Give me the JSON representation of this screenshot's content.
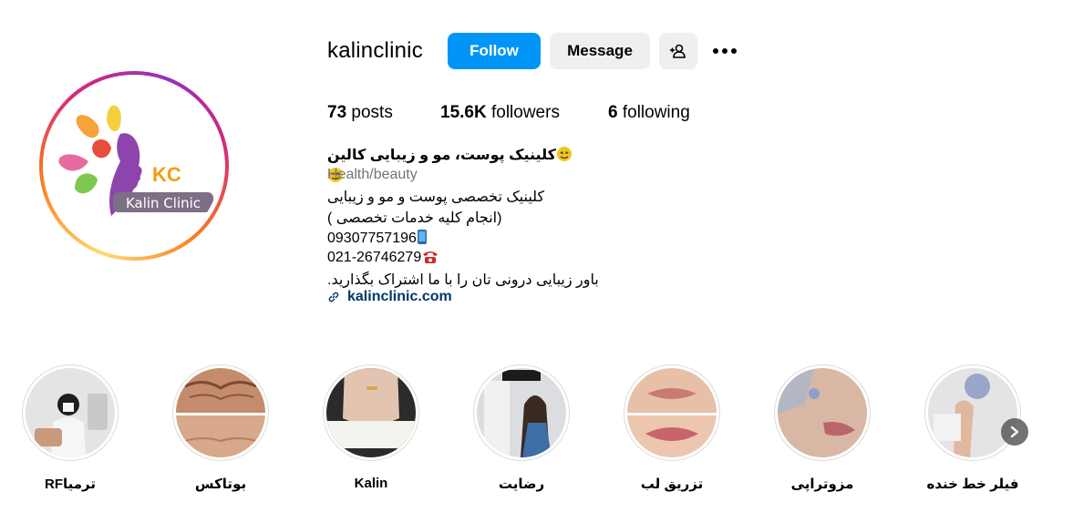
{
  "profile": {
    "username": "kalinclinic",
    "follow_label": "Follow",
    "message_label": "Message",
    "avatar_text": "Kalin Clinic",
    "avatar_monogram": "KC"
  },
  "stats": {
    "posts_count": "73",
    "posts_label": "posts",
    "followers_count": "15.6K",
    "followers_label": "followers",
    "following_count": "6",
    "following_label": "following"
  },
  "bio": {
    "name": "کلینیک پوست، مو و زیبایی کالین",
    "category": "Health/beauty",
    "line1": "کلینیک تخصصی پوست و مو و زیبایی",
    "line2": "(انجام کلیه خدمات تخصصی )",
    "phone1": "09307757196",
    "phone2": "021-26746279",
    "line5": "باور زیبایی درونی تان را با ما اشتراک بگذارید.",
    "link": "kalinclinic.com"
  },
  "highlights": [
    {
      "label": "RFترمیا"
    },
    {
      "label": "بوتاکس"
    },
    {
      "label": "Kalin"
    },
    {
      "label": "رضایت"
    },
    {
      "label": "تزریق لب"
    },
    {
      "label": "مزوتراپی"
    },
    {
      "label": "فیلر خط خنده"
    }
  ],
  "colors": {
    "follow_button": "#0095f6",
    "secondary_button": "#efefef",
    "link": "#00376b",
    "muted_text": "#737373"
  },
  "icons": {
    "add_user": "add-user-icon",
    "more": "more-options-icon",
    "link": "link-icon",
    "next": "chevron-right-icon"
  }
}
